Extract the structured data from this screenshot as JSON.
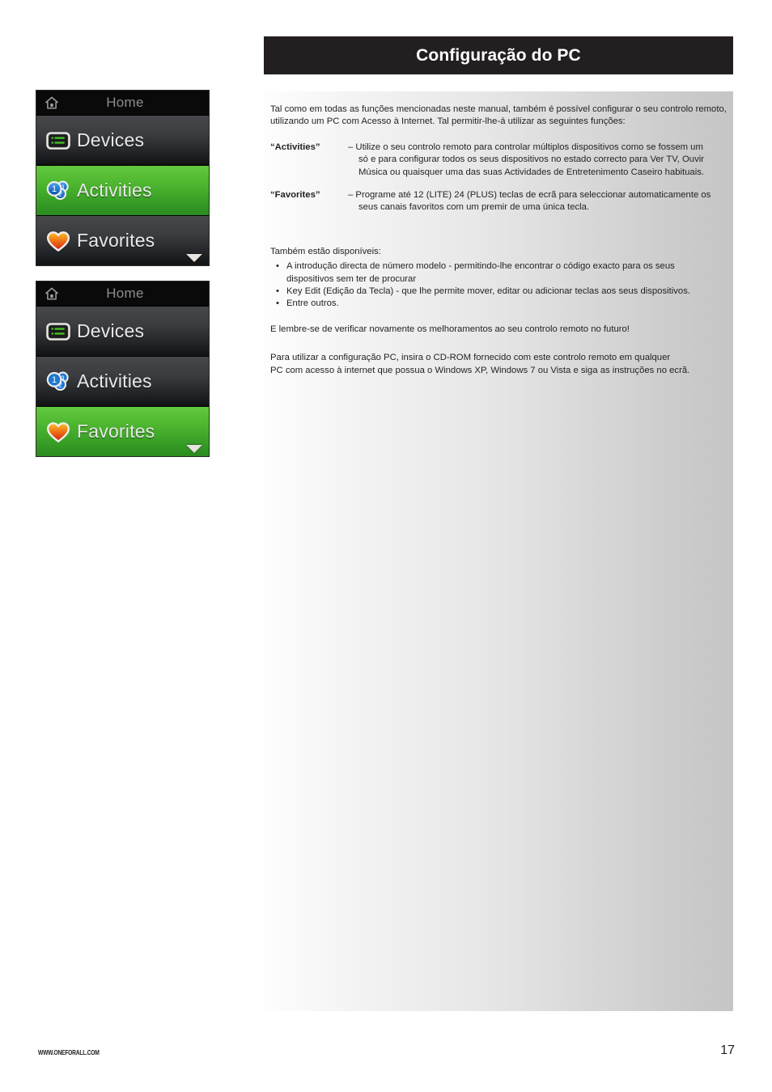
{
  "header": {
    "title": "Configuração do PC"
  },
  "content": {
    "intro": "Tal como em todas as funções mencionadas neste manual, também é possível configurar o seu controlo remoto, utilizando um PC com Acesso à Internet. Tal permitir-lhe-á utilizar as seguintes funções:",
    "definitions": [
      {
        "term": "“Activities”",
        "line1": "– Utilize o seu controlo remoto para controlar múltiplos dispositivos como se fossem um",
        "line2": "só e para configurar todos os seus dispositivos no estado correcto para Ver TV, Ouvir",
        "line3": "Música ou quaisquer uma das suas Actividades de Entretenimento Caseiro habituais."
      },
      {
        "term": "“Favorites”",
        "line1": "– Programe até 12 (LITE) 24 (PLUS) teclas de ecrã para seleccionar automaticamente os",
        "line2": "seus canais favoritos com um premir de uma única tecla.",
        "line3": ""
      }
    ],
    "also_available_label": "Também estão disponíveis:",
    "bullets": [
      {
        "line1": "A introdução directa de número modelo - permitindo-lhe encontrar o código exacto para os seus",
        "line2": "dispositivos sem ter de procurar"
      },
      {
        "line1": "Key Edit (Edição da Tecla)  - que lhe permite mover, editar ou adicionar teclas aos seus dispositivos.",
        "line2": ""
      },
      {
        "line1": "Entre outros.",
        "line2": ""
      }
    ],
    "reminder": "E lembre-se de verificar novamente os melhoramentos ao seu controlo remoto no futuro!",
    "closing_line1": "Para utilizar a configuração PC, insira o CD-ROM fornecido com este controlo remoto em qualquer",
    "closing_line2": "PC com acesso à internet que possua o Windows XP,  Windows 7 ou Vista e siga as instruções no ecrã."
  },
  "remote_screens": [
    {
      "titlebar": "Home",
      "rows": [
        {
          "label": "Devices",
          "icon": "devices-icon",
          "selected": false
        },
        {
          "label": "Activities",
          "icon": "activities-icon",
          "selected": true
        },
        {
          "label": "Favorites",
          "icon": "favorites-heart-icon",
          "selected": false
        }
      ]
    },
    {
      "titlebar": "Home",
      "rows": [
        {
          "label": "Devices",
          "icon": "devices-icon",
          "selected": false
        },
        {
          "label": "Activities",
          "icon": "activities-icon",
          "selected": false
        },
        {
          "label": "Favorites",
          "icon": "favorites-heart-icon",
          "selected": true
        }
      ]
    }
  ],
  "footer": {
    "url": "WWW.ONEFORALL.COM",
    "page_number": "17"
  },
  "colors": {
    "header_bg": "#231f20",
    "highlight_green_top": "#62c93f",
    "highlight_green_bottom": "#2b8a1f",
    "screen_row_dark": "#3a3c3f",
    "heart_orange": "#f5a623",
    "heart_red": "#d7261e",
    "bubble_blue": "#1f78d1",
    "devices_green": "#45c020"
  }
}
